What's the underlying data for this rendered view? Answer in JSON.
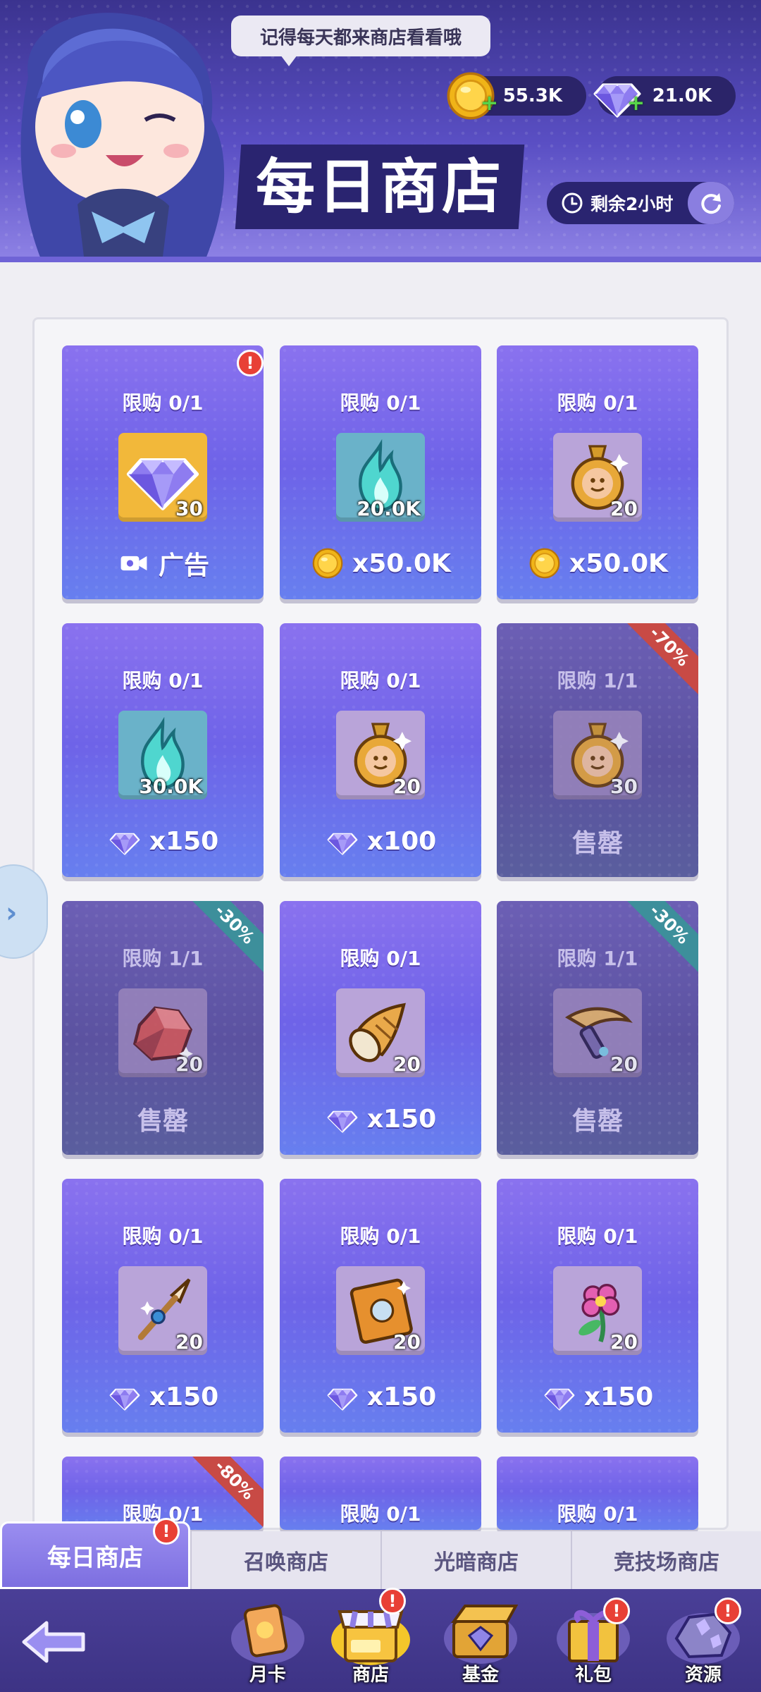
{
  "header": {
    "speech": "记得每天都来商店看看哦",
    "coins": "55.3K",
    "gems": "21.0K",
    "title": "每日商店",
    "timer": "剩余2小时"
  },
  "cards": [
    {
      "limit": "限购 0/1",
      "qty": "30",
      "price": "广告",
      "item": "gem-icon",
      "price_icon": "video-ad-icon",
      "slot": "gold"
    },
    {
      "limit": "限购 0/1",
      "qty": "20.0K",
      "price": "x50.0K",
      "item": "spirit-flame-icon",
      "price_icon": "coin-icon",
      "slot": "teal"
    },
    {
      "limit": "限购 0/1",
      "qty": "20",
      "price": "x50.0K",
      "item": "amulet-icon",
      "price_icon": "coin-icon",
      "slot": "pink"
    },
    {
      "limit": "限购 0/1",
      "qty": "30.0K",
      "price": "x150",
      "item": "spirit-flame-icon",
      "price_icon": "gem-icon",
      "slot": "teal"
    },
    {
      "limit": "限购 0/1",
      "qty": "20",
      "price": "x100",
      "item": "amulet-icon",
      "price_icon": "gem-icon",
      "slot": "pink"
    },
    {
      "limit": "限购 1/1",
      "qty": "30",
      "price": "售罄",
      "item": "amulet-icon",
      "sold": true,
      "badge": "-70%",
      "badge_color": "red",
      "slot": "pink"
    },
    {
      "limit": "限购 1/1",
      "qty": "20",
      "price": "售罄",
      "item": "red-ore-icon",
      "sold": true,
      "badge": "-30%",
      "badge_color": "teal",
      "slot": "pink"
    },
    {
      "limit": "限购 0/1",
      "qty": "20",
      "price": "x150",
      "item": "horn-icon",
      "price_icon": "gem-icon",
      "slot": "pink"
    },
    {
      "limit": "限购 1/1",
      "qty": "20",
      "price": "售罄",
      "item": "dagger-icon",
      "sold": true,
      "badge": "-30%",
      "badge_color": "teal",
      "slot": "pink"
    },
    {
      "limit": "限购 0/1",
      "qty": "20",
      "price": "x150",
      "item": "spear-icon",
      "price_icon": "gem-icon",
      "slot": "pink"
    },
    {
      "limit": "限购 0/1",
      "qty": "20",
      "price": "x150",
      "item": "book-icon",
      "price_icon": "gem-icon",
      "slot": "pink"
    },
    {
      "limit": "限购 0/1",
      "qty": "20",
      "price": "x150",
      "item": "flower-icon",
      "price_icon": "gem-icon",
      "slot": "pink"
    },
    {
      "limit": "限购 0/1",
      "badge": "-80%",
      "badge_color": "red"
    },
    {
      "limit": "限购 0/1"
    },
    {
      "limit": "限购 0/1"
    }
  ],
  "tabs": [
    "每日商店",
    "召唤商店",
    "光暗商店",
    "竞技场商店"
  ],
  "nav": [
    {
      "label": "月卡",
      "icon": "month-card-icon",
      "alert": false
    },
    {
      "label": "商店",
      "icon": "shop-icon",
      "alert": true
    },
    {
      "label": "基金",
      "icon": "fund-chest-icon",
      "alert": false
    },
    {
      "label": "礼包",
      "icon": "gift-box-icon",
      "alert": true
    },
    {
      "label": "资源",
      "icon": "resource-ore-icon",
      "alert": true
    }
  ],
  "alert_mark": "!"
}
